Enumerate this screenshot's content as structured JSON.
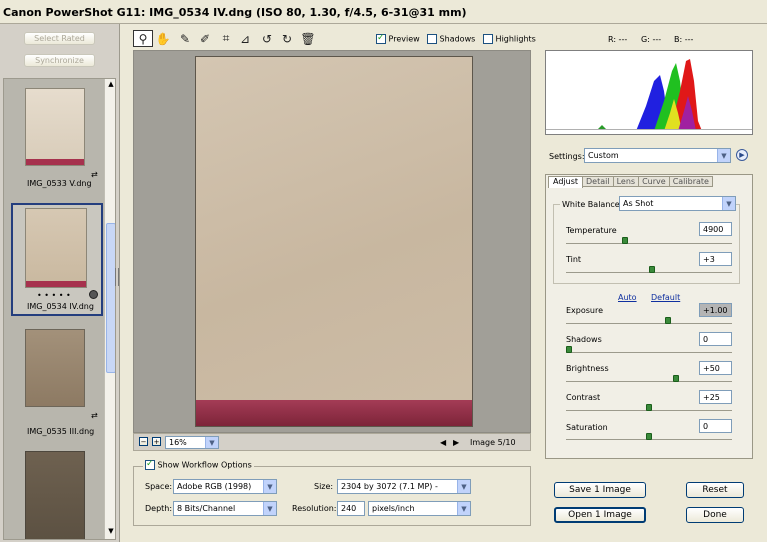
{
  "window_title": "Canon PowerShot G11:  IMG_0534 IV.dng  (ISO 80, 1.30, f/4.5, 6-31@31 mm)",
  "filmstrip": {
    "select_rated": "Select Rated",
    "synchronize": "Synchronize",
    "items": [
      {
        "name": "IMG_0533 V.dng"
      },
      {
        "name": "IMG_0534 IV.dng",
        "rating": "• • • • •"
      },
      {
        "name": "IMG_0535 III.dng"
      }
    ]
  },
  "toolbar": {
    "tools": [
      "zoom-icon",
      "hand-icon",
      "white-balance-icon",
      "color-sampler-icon",
      "crop-icon",
      "straighten-icon",
      "rotate-left-icon",
      "rotate-right-icon",
      "trash-icon"
    ],
    "preview_label": "Preview",
    "preview_checked": true,
    "shadows_label": "Shadows",
    "shadows_checked": false,
    "highlights_label": "Highlights",
    "highlights_checked": false
  },
  "rgb_readout": {
    "r": "R:  ---",
    "g": "G:  ---",
    "b": "B:  ---"
  },
  "preview_footer": {
    "zoom_minus": "−",
    "zoom_plus": "+",
    "zoom_value": "16%",
    "image_counter": "Image 5/10"
  },
  "settings": {
    "label": "Settings:",
    "value": "Custom"
  },
  "tabs": [
    "Adjust",
    "Detail",
    "Lens",
    "Curve",
    "Calibrate"
  ],
  "white_balance": {
    "label": "White Balance:",
    "value": "As Shot"
  },
  "adjust": {
    "temperature": {
      "label": "Temperature",
      "value": "4900",
      "level": 0.35
    },
    "tint": {
      "label": "Tint",
      "value": "+3",
      "level": 0.52
    },
    "auto": "Auto",
    "default": "Default",
    "exposure": {
      "label": "Exposure",
      "value": "+1.00",
      "level": 0.62
    },
    "shadows": {
      "label": "Shadows",
      "value": "0",
      "level": 0.0
    },
    "brightness": {
      "label": "Brightness",
      "value": "+50",
      "level": 0.67
    },
    "contrast": {
      "label": "Contrast",
      "value": "+25",
      "level": 0.5
    },
    "saturation": {
      "label": "Saturation",
      "value": "0",
      "level": 0.5
    }
  },
  "workflow": {
    "show_label": "Show Workflow Options",
    "show_checked": true,
    "space_label": "Space:",
    "space_value": "Adobe RGB (1998)",
    "depth_label": "Depth:",
    "depth_value": "8 Bits/Channel",
    "size_label": "Size:",
    "size_value": "2304 by 3072  (7.1 MP)   -",
    "resolution_label": "Resolution:",
    "resolution_value": "240",
    "resolution_unit": "pixels/inch"
  },
  "actions": {
    "save": "Save 1 Image",
    "open": "Open 1 Image",
    "reset": "Reset",
    "done": "Done"
  }
}
